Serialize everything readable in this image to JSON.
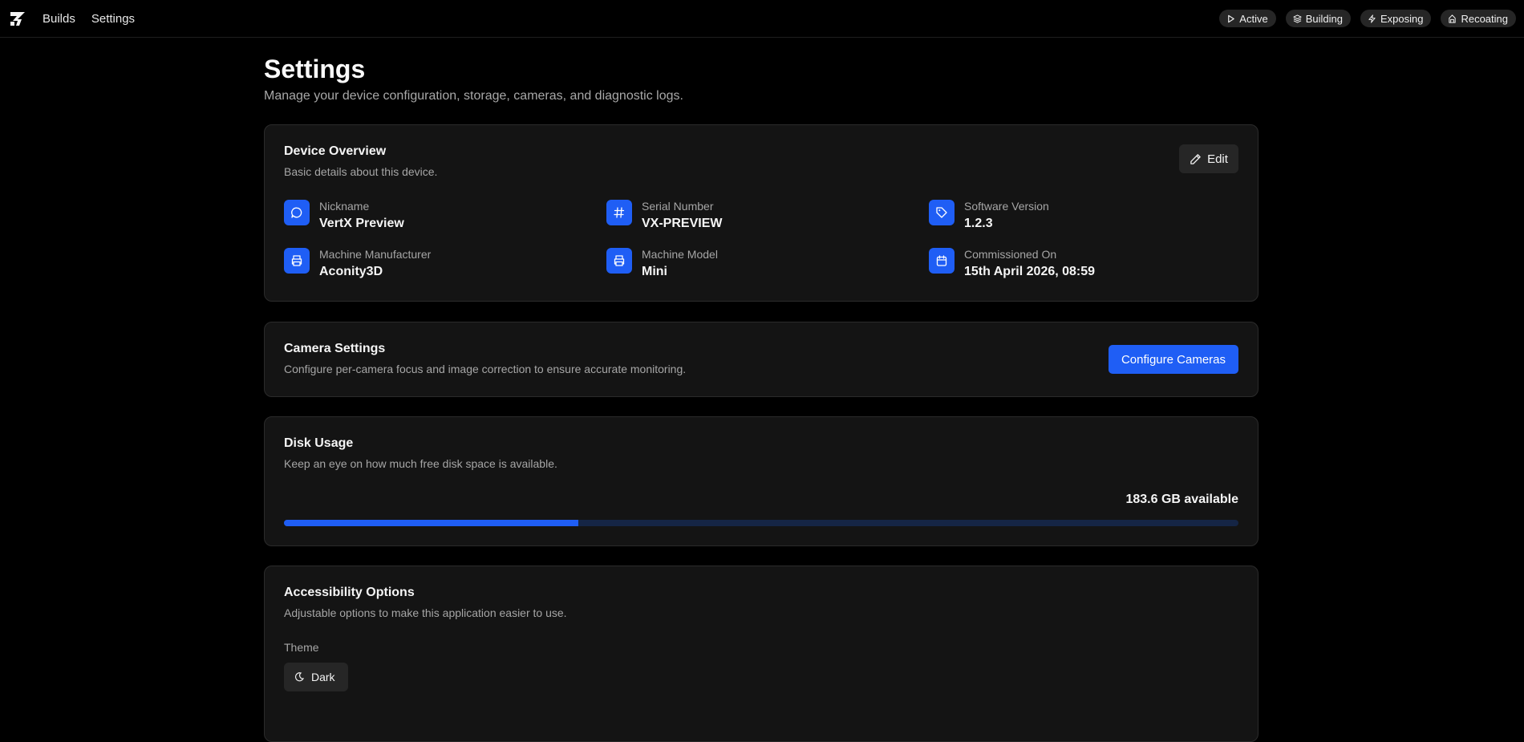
{
  "nav": {
    "builds": "Builds",
    "settings": "Settings"
  },
  "statuses": [
    {
      "label": "Active",
      "icon": "play-icon"
    },
    {
      "label": "Building",
      "icon": "layers-icon"
    },
    {
      "label": "Exposing",
      "icon": "zap-icon"
    },
    {
      "label": "Recoating",
      "icon": "recoater-icon"
    }
  ],
  "page": {
    "title": "Settings",
    "subtitle": "Manage your device configuration, storage, cameras, and diagnostic logs."
  },
  "device_overview": {
    "title": "Device Overview",
    "description": "Basic details about this device.",
    "edit_label": "Edit",
    "fields": [
      {
        "label": "Nickname",
        "value": "VertX Preview",
        "icon": "message-circle-icon"
      },
      {
        "label": "Serial Number",
        "value": "VX-PREVIEW",
        "icon": "hash-icon"
      },
      {
        "label": "Software Version",
        "value": "1.2.3",
        "icon": "tag-icon"
      },
      {
        "label": "Machine Manufacturer",
        "value": "Aconity3D",
        "icon": "printer-icon"
      },
      {
        "label": "Machine Model",
        "value": "Mini",
        "icon": "printer-icon"
      },
      {
        "label": "Commissioned On",
        "value": "15th April 2026, 08:59",
        "icon": "calendar-icon"
      }
    ]
  },
  "camera_settings": {
    "title": "Camera Settings",
    "description": "Configure per-camera focus and image correction to ensure accurate monitoring.",
    "button_label": "Configure Cameras"
  },
  "disk_usage": {
    "title": "Disk Usage",
    "description": "Keep an eye on how much free disk space is available.",
    "available_text": "183.6 GB available",
    "used_fraction": 0.308
  },
  "accessibility": {
    "title": "Accessibility Options",
    "description": "Adjustable options to make this application easier to use.",
    "theme_label": "Theme",
    "theme_value": "Dark"
  },
  "colors": {
    "accent": "#1f5ef5",
    "background": "#000000",
    "card": "#141414"
  }
}
